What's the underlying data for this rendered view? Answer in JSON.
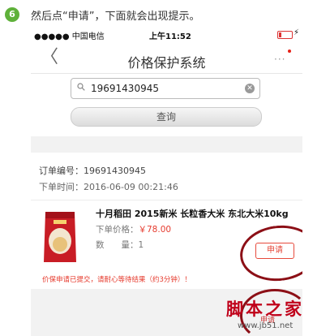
{
  "step": {
    "number": "6",
    "text": "然后点“申请”，下面就会出现提示。"
  },
  "statusbar": {
    "carrier": "●●●●● 中国电信",
    "time": "上午11:52",
    "battery_icon": "battery-low-icon",
    "charging_icon": "charging-bolt-icon"
  },
  "navbar": {
    "back_icon": "back-chevron-icon",
    "title": "价格保护系统",
    "more_icon": "more-dots-icon"
  },
  "search": {
    "value": "19691430945",
    "search_icon": "search-icon",
    "clear_icon": "clear-icon",
    "query_label": "查询"
  },
  "order": {
    "number_label": "订单编号：",
    "number": "19691430945",
    "time_label": "下单时间：",
    "time": "2016-06-09 00:21:46"
  },
  "product": {
    "name": "十月稻田 2015新米 长粒香大米 东北大米10kg",
    "price_label": "下单价格：",
    "price": "￥78.00",
    "qty_label": "数　　量：",
    "qty": "1",
    "apply_label": "申请"
  },
  "notice": "价保申请已提交，请耐心等待结果（约3分钟）！",
  "annotation": {
    "apply_copy": "申请"
  },
  "watermark": {
    "cn": "脚本之家",
    "url": "www.jb51.net"
  },
  "colors": {
    "accent_red": "#e63b2e",
    "step_green": "#5fb13a",
    "annotation": "#8c0f16"
  }
}
